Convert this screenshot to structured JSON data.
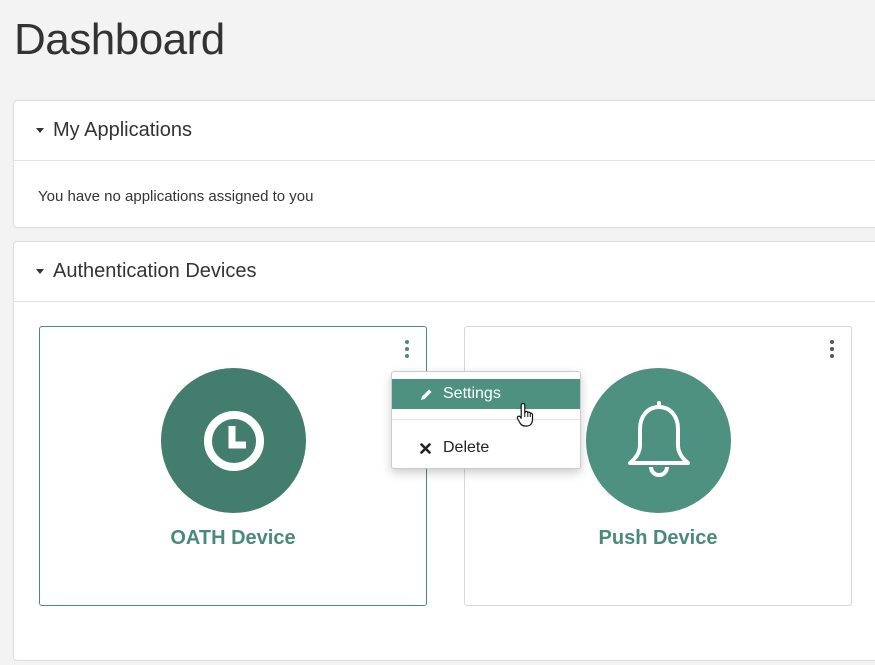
{
  "page": {
    "title": "Dashboard"
  },
  "my_applications": {
    "header": "My Applications",
    "empty_message": "You have no applications assigned to you"
  },
  "authentication_devices": {
    "header": "Authentication Devices",
    "devices": [
      {
        "name": "OATH Device",
        "icon": "clock-icon"
      },
      {
        "name": "Push Device",
        "icon": "bell-icon"
      }
    ]
  },
  "device_menu": {
    "settings_label": "Settings",
    "settings_icon": "pencil-icon",
    "delete_label": "Delete",
    "delete_icon": "x-icon"
  },
  "colors": {
    "accent": "#4f9181",
    "accent_dark": "#437d6e",
    "device_name": "#4b8a78"
  }
}
